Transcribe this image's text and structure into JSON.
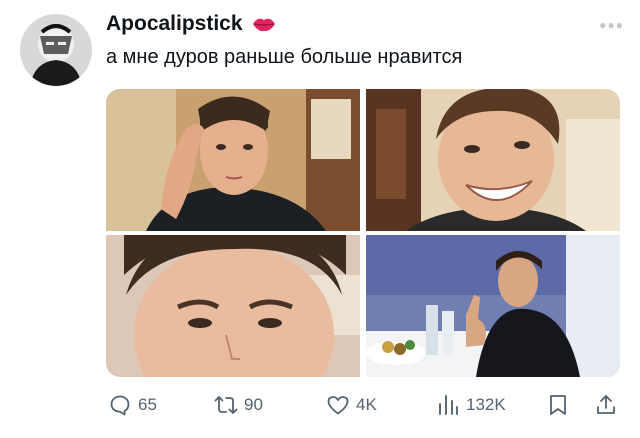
{
  "tweet": {
    "author_name": "Apocalipstick",
    "author_badge_icon": "lips-kiss-icon",
    "text": "а мне дуров раньше больше нравится",
    "more_icon": "more-dots-icon"
  },
  "media": {
    "count": 4,
    "photos": [
      {
        "icon": "photo-man-hand-on-temple"
      },
      {
        "icon": "photo-man-smiling-closeup"
      },
      {
        "icon": "photo-man-frowning-closeup"
      },
      {
        "icon": "photo-man-restaurant-gesture"
      }
    ]
  },
  "actions": {
    "reply_count": "65",
    "retweet_count": "90",
    "like_count": "4K",
    "views_count": "132K"
  },
  "colors": {
    "text": "#0f1419",
    "muted": "#536471",
    "lips": "#e0245e"
  }
}
